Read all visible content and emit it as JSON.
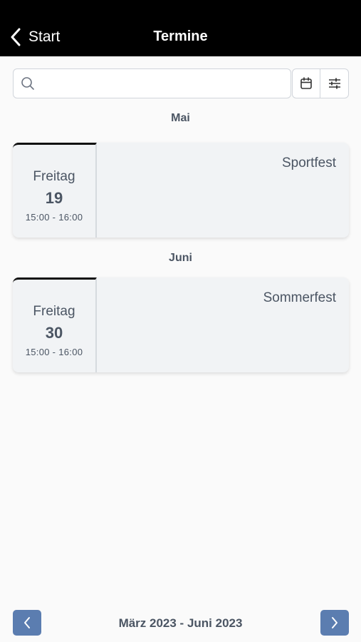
{
  "header": {
    "back_label": "Start",
    "title": "Termine"
  },
  "search": {
    "placeholder": "",
    "value": ""
  },
  "icons": {
    "back": "chevron-left-icon",
    "search": "search-icon",
    "calendar": "calendar-icon",
    "filter": "sliders-icon",
    "prev": "chevron-left-icon",
    "next": "chevron-right-icon"
  },
  "groups": [
    {
      "month": "Mai",
      "events": [
        {
          "weekday": "Freitag",
          "day": "19",
          "time": "15:00 - 16:00",
          "title": "Sportfest"
        }
      ]
    },
    {
      "month": "Juni",
      "events": [
        {
          "weekday": "Freitag",
          "day": "30",
          "time": "15:00 - 16:00",
          "title": "Sommerfest"
        }
      ]
    }
  ],
  "footer": {
    "range_label": "März 2023 - Juni 2023"
  },
  "colors": {
    "header_bg": "#000000",
    "accent": "#5b7db0",
    "card_bg": "#f1f3f5",
    "text": "#4b5563"
  }
}
